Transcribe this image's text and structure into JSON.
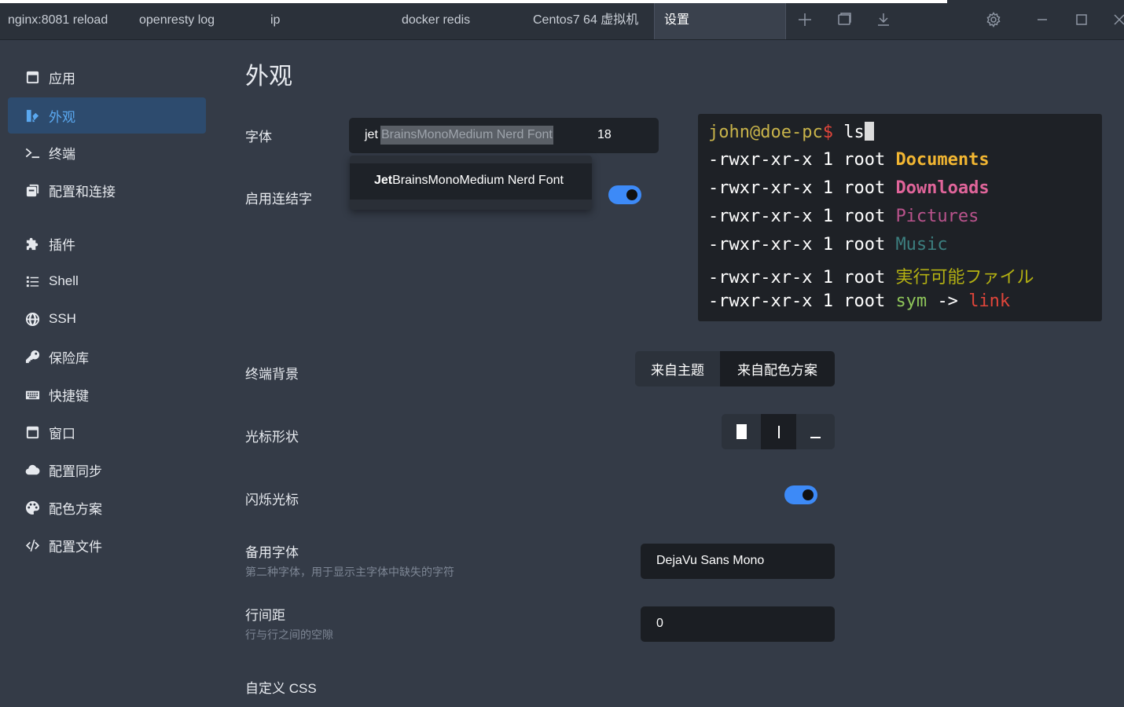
{
  "tabs": [
    {
      "label": "nginx:8081 reload"
    },
    {
      "label": "openresty log"
    },
    {
      "label": "ip"
    },
    {
      "label": "docker redis"
    },
    {
      "label": "Centos7 64 虚拟机"
    },
    {
      "label": "设置"
    }
  ],
  "toolbar_icons": [
    "plus-icon",
    "window-icon",
    "download-icon",
    "gear-icon",
    "minimize-icon",
    "maximize-icon",
    "close-icon"
  ],
  "sidebar": {
    "items": [
      {
        "label": "应用",
        "icon": "window-icon"
      },
      {
        "label": "外观",
        "icon": "palette-brush-icon",
        "active": true
      },
      {
        "label": "终端",
        "icon": "terminal-prompt-icon"
      },
      {
        "label": "配置和连接",
        "icon": "copy-icon"
      },
      {
        "label": "插件",
        "icon": "puzzle-icon"
      },
      {
        "label": "Shell",
        "icon": "list-icon"
      },
      {
        "label": "SSH",
        "icon": "globe-icon"
      },
      {
        "label": "保险库",
        "icon": "key-icon"
      },
      {
        "label": "快捷键",
        "icon": "keyboard-icon"
      },
      {
        "label": "窗口",
        "icon": "window-icon"
      },
      {
        "label": "配置同步",
        "icon": "cloud-icon"
      },
      {
        "label": "配色方案",
        "icon": "palette-icon"
      },
      {
        "label": "配置文件",
        "icon": "code-icon"
      }
    ]
  },
  "main": {
    "title": "外观",
    "font": {
      "label": "字体",
      "typed": "jet",
      "completion": "BrainsMonoMedium Nerd Font",
      "size": "18",
      "suggestion_bold": "Jet",
      "suggestion_rest": "BrainsMonoMedium Nerd Font"
    },
    "ligatures": {
      "label": "启用连结字",
      "enabled": true
    },
    "terminal_preview": {
      "prompt_user": "john@doe-pc",
      "prompt_symbol": "$",
      "command": "ls",
      "lines": [
        {
          "perm": "-rwxr-xr-x",
          "links": "1",
          "owner": "root",
          "name": "Documents",
          "color": "#f2b632",
          "bold": true
        },
        {
          "perm": "-rwxr-xr-x",
          "links": "1",
          "owner": "root",
          "name": "Downloads",
          "color": "#e0659a",
          "bold": true
        },
        {
          "perm": "-rwxr-xr-x",
          "links": "1",
          "owner": "root",
          "name": "Pictures",
          "color": "#b9538c",
          "bold": false
        },
        {
          "perm": "-rwxr-xr-x",
          "links": "1",
          "owner": "root",
          "name": "Music",
          "color": "#3c7f7f",
          "bold": false
        },
        {
          "perm": "-rwxr-xr-x",
          "links": "1",
          "owner": "root",
          "name": "実行可能ファイル",
          "color": "#b3b012",
          "bold": false
        },
        {
          "perm": "-rwxr-xr-x",
          "links": "1",
          "owner": "root",
          "name": "sym",
          "color": "#8fc65a",
          "bold": false,
          "arrow": "->",
          "target": "link",
          "target_color": "#e0453a"
        }
      ]
    },
    "terminal_bg": {
      "label": "终端背景",
      "options": [
        "来自主题",
        "来自配色方案"
      ],
      "selected": 1
    },
    "cursor_shape": {
      "label": "光标形状",
      "options": [
        "block",
        "beam",
        "underline"
      ],
      "selected": 1
    },
    "blink_cursor": {
      "label": "闪烁光标",
      "enabled": true
    },
    "fallback_font": {
      "label": "备用字体",
      "description": "第二种字体，用于显示主字体中缺失的字符",
      "value": "DejaVu Sans Mono"
    },
    "line_spacing": {
      "label": "行间距",
      "description": "行与行之间的空隙",
      "value": "0"
    },
    "custom_css": {
      "label": "自定义 CSS"
    }
  },
  "colors": {
    "accent": "#3d8af7",
    "active_nav_bg": "#2d4b6e",
    "active_nav_fg": "#5aa8f0",
    "prompt_user": "#c8b34a",
    "prompt_symbol": "#e0453a"
  }
}
